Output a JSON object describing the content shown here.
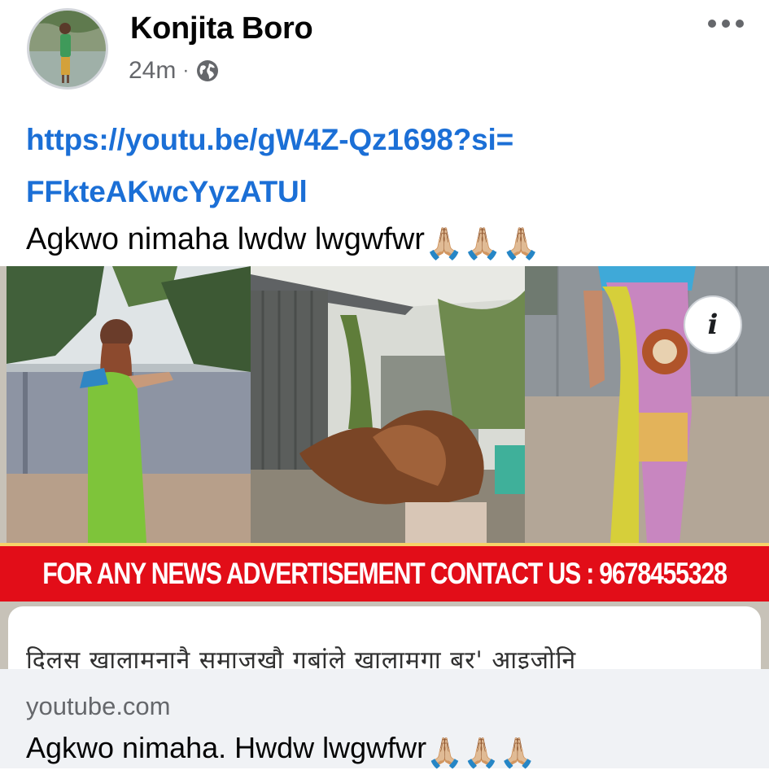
{
  "post": {
    "author": "Konjita Boro",
    "time": "24m",
    "separator": "·",
    "privacy_icon": "globe-icon",
    "more_icon": "more-horizontal-icon",
    "link_line1": "https://youtu.be/gW4Z-Qz1698?si=",
    "link_line2": "FFkteAKwcYyzATUl",
    "caption": "Agkwo nimaha lwdw lwgwfwr",
    "caption_emoji": "🙏🏼🙏🏼🙏🏼"
  },
  "preview": {
    "banner": "FOR ANY NEWS ADVERTISEMENT CONTACT US : 9678455328",
    "subtitle_text": "दिलस खालामनानै समाजखौ गबांले खालामगा बर' आइजोनि",
    "info_icon": "info-icon",
    "info_label": "i"
  },
  "link_preview": {
    "domain": "youtube.com",
    "title": "Agkwo nimaha. Hwdw lwgwfwr",
    "title_emoji": "🙏🏼🙏🏼🙏🏼"
  },
  "colors": {
    "link": "#1b6fd6",
    "banner": "#e20d18",
    "footer_bg": "#f0f2f5",
    "meta_text": "#65676b"
  }
}
